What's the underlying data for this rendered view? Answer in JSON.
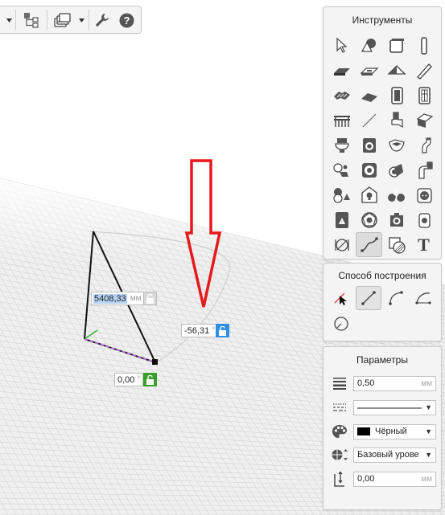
{
  "toolbar": {
    "items": [
      {
        "name": "dropdown-arrow-icon"
      },
      {
        "name": "hierarchy-icon"
      },
      {
        "name": "layers-icon"
      },
      {
        "name": "wrench-icon"
      },
      {
        "name": "help-icon",
        "glyph": "?"
      }
    ]
  },
  "tools_panel": {
    "title": "Инструменты",
    "tools": [
      "select-arrow-icon",
      "shapes-icon",
      "box-icon",
      "column-icon",
      "wall-icon",
      "slab-icon",
      "roof-icon",
      "beam-icon",
      "stairs-icon",
      "ramp-icon",
      "door-icon",
      "window-icon",
      "railing-icon",
      "line-icon",
      "chair-icon",
      "corner-window-icon",
      "toilet-icon",
      "washer-icon",
      "bathtub-icon",
      "pipe-icon",
      "pipe-fittings-icon",
      "radiator-icon",
      "pipe-roll-icon",
      "duct-icon",
      "valve-icon",
      "lamp-icon",
      "electric-bike-icon",
      "socket-icon",
      "fire-panel-icon",
      "fire-ball-icon",
      "camera-icon",
      "plug-icon",
      "dimension-icon",
      "curve-icon",
      "hatch-icon",
      "text-icon"
    ],
    "active_tool": "curve-icon",
    "text_tool_glyph": "T"
  },
  "mode_panel": {
    "title": "Способ построения",
    "modes": [
      "pick-line-icon",
      "two-point-line-icon",
      "arc-icon",
      "tangent-arc-icon",
      "circle-arc-icon"
    ],
    "active_mode": "two-point-line-icon"
  },
  "params_panel": {
    "title": "Параметры",
    "thickness": {
      "value": "0,50",
      "unit": "мм"
    },
    "line_type": {
      "value": ""
    },
    "color": {
      "value": "Чёрный",
      "swatch": "#000000"
    },
    "level": {
      "value": "Базовый урове"
    },
    "offset": {
      "value": "0,00",
      "unit": "мм"
    }
  },
  "canvas": {
    "length_input": {
      "value": "5408,33",
      "unit": "мм"
    },
    "angle_input": {
      "value": "-56,31",
      "unit": "°"
    },
    "rotation_input": {
      "value": "0,00",
      "unit": "°"
    },
    "arrow_color": "#e8191a",
    "lock_color_blue": "#2f8fe6",
    "lock_color_green": "#3aa02c"
  }
}
